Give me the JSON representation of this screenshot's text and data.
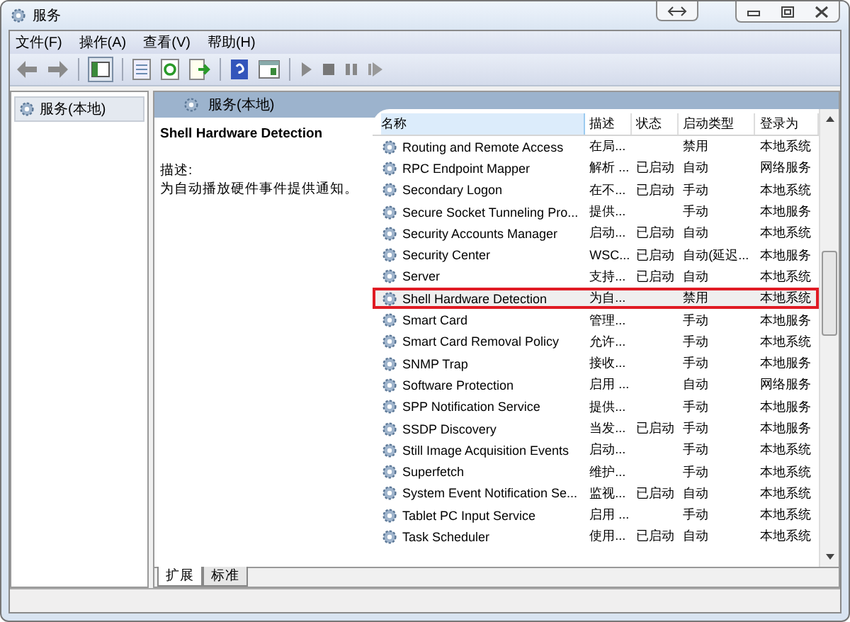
{
  "window": {
    "title": "服务"
  },
  "menu": [
    "文件(F)",
    "操作(A)",
    "查看(V)",
    "帮助(H)"
  ],
  "toolbar": [
    {
      "kind": "back"
    },
    {
      "kind": "forward"
    },
    {
      "kind": "sep"
    },
    {
      "kind": "tree"
    },
    {
      "kind": "sep"
    },
    {
      "kind": "list"
    },
    {
      "kind": "refresh"
    },
    {
      "kind": "export"
    },
    {
      "kind": "sep"
    },
    {
      "kind": "help"
    },
    {
      "kind": "props"
    },
    {
      "kind": "sep"
    },
    {
      "kind": "play"
    },
    {
      "kind": "stop"
    },
    {
      "kind": "pause"
    },
    {
      "kind": "resume"
    }
  ],
  "tree": {
    "items": [
      {
        "label": "服务(本地)",
        "selected": true
      }
    ]
  },
  "pane": {
    "title": "服务(本地)"
  },
  "details": {
    "name": "Shell Hardware Detection",
    "desc_label": "描述:",
    "desc": "为自动播放硬件事件提供通知。"
  },
  "table": {
    "columns": [
      "名称",
      "描述",
      "状态",
      "启动类型",
      "登录为"
    ],
    "rows": [
      {
        "name": "Routing and Remote Access",
        "desc": "在局...",
        "status": "",
        "startup": "禁用",
        "logon": "本地系统",
        "selected": false
      },
      {
        "name": "RPC Endpoint Mapper",
        "desc": "解析 ...",
        "status": "已启动",
        "startup": "自动",
        "logon": "网络服务",
        "selected": false
      },
      {
        "name": "Secondary Logon",
        "desc": "在不...",
        "status": "已启动",
        "startup": "手动",
        "logon": "本地系统",
        "selected": false
      },
      {
        "name": "Secure Socket Tunneling Pro...",
        "desc": "提供...",
        "status": "",
        "startup": "手动",
        "logon": "本地服务",
        "selected": false
      },
      {
        "name": "Security Accounts Manager",
        "desc": "启动...",
        "status": "已启动",
        "startup": "自动",
        "logon": "本地系统",
        "selected": false
      },
      {
        "name": "Security Center",
        "desc": "WSC...",
        "status": "已启动",
        "startup": "自动(延迟...",
        "logon": "本地服务",
        "selected": false
      },
      {
        "name": "Server",
        "desc": "支持...",
        "status": "已启动",
        "startup": "自动",
        "logon": "本地系统",
        "selected": false
      },
      {
        "name": "Shell Hardware Detection",
        "desc": "为自...",
        "status": "",
        "startup": "禁用",
        "logon": "本地系统",
        "selected": true
      },
      {
        "name": "Smart Card",
        "desc": "管理...",
        "status": "",
        "startup": "手动",
        "logon": "本地服务",
        "selected": false
      },
      {
        "name": "Smart Card Removal Policy",
        "desc": "允许...",
        "status": "",
        "startup": "手动",
        "logon": "本地系统",
        "selected": false
      },
      {
        "name": "SNMP Trap",
        "desc": "接收...",
        "status": "",
        "startup": "手动",
        "logon": "本地服务",
        "selected": false
      },
      {
        "name": "Software Protection",
        "desc": "启用 ...",
        "status": "",
        "startup": "自动",
        "logon": "网络服务",
        "selected": false
      },
      {
        "name": "SPP Notification Service",
        "desc": "提供...",
        "status": "",
        "startup": "手动",
        "logon": "本地服务",
        "selected": false
      },
      {
        "name": "SSDP Discovery",
        "desc": "当发...",
        "status": "已启动",
        "startup": "手动",
        "logon": "本地服务",
        "selected": false
      },
      {
        "name": "Still Image Acquisition Events",
        "desc": "启动...",
        "status": "",
        "startup": "手动",
        "logon": "本地系统",
        "selected": false
      },
      {
        "name": "Superfetch",
        "desc": "维护...",
        "status": "",
        "startup": "手动",
        "logon": "本地系统",
        "selected": false
      },
      {
        "name": "System Event Notification Se...",
        "desc": "监视...",
        "status": "已启动",
        "startup": "自动",
        "logon": "本地系统",
        "selected": false
      },
      {
        "name": "Tablet PC Input Service",
        "desc": "启用 ...",
        "status": "",
        "startup": "手动",
        "logon": "本地系统",
        "selected": false
      },
      {
        "name": "Task Scheduler",
        "desc": "使用...",
        "status": "已启动",
        "startup": "自动",
        "logon": "本地系统",
        "selected": false
      }
    ]
  },
  "tabs": [
    {
      "label": "扩展",
      "selected": true
    },
    {
      "label": "标准",
      "selected": false
    }
  ]
}
